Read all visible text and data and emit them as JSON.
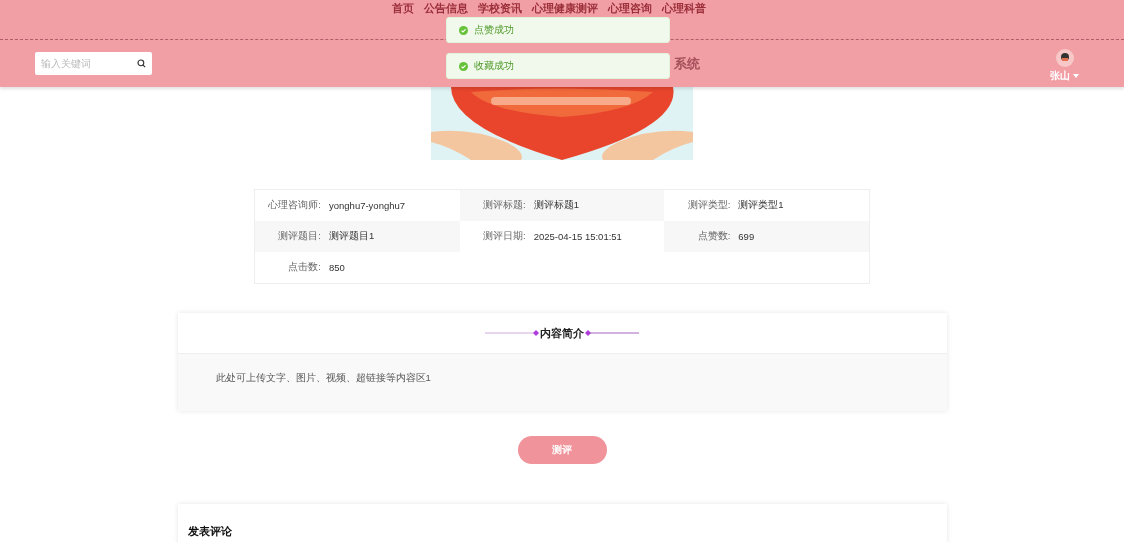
{
  "nav": [
    {
      "label": "首页"
    },
    {
      "label": "公告信息"
    },
    {
      "label": "学校资讯"
    },
    {
      "label": "心理健康测评"
    },
    {
      "label": "心理咨询"
    },
    {
      "label": "心理科普"
    }
  ],
  "toasts": [
    {
      "text": "点赞成功"
    },
    {
      "text": "收藏成功"
    }
  ],
  "search": {
    "placeholder": "输入关键词"
  },
  "site_title": "系统",
  "user": {
    "name": "张山"
  },
  "details": [
    {
      "label": "心理咨询师:",
      "value": "yonghu7-yonghu7"
    },
    {
      "label": "测评标题:",
      "value": "测评标题1"
    },
    {
      "label": "测评类型:",
      "value": "测评类型1"
    },
    {
      "label": "测评题目:",
      "value": "测评题目1"
    },
    {
      "label": "测评日期:",
      "value": "2025-04-15 15:01:51"
    },
    {
      "label": "点赞数:",
      "value": "699"
    },
    {
      "label": "点击数:",
      "value": "850"
    }
  ],
  "intro": {
    "title": "内容简介",
    "body": "此处可上传文字、图片、视频、超链接等内容区1"
  },
  "action_button": "测评",
  "comment": {
    "title": "发表评论"
  }
}
